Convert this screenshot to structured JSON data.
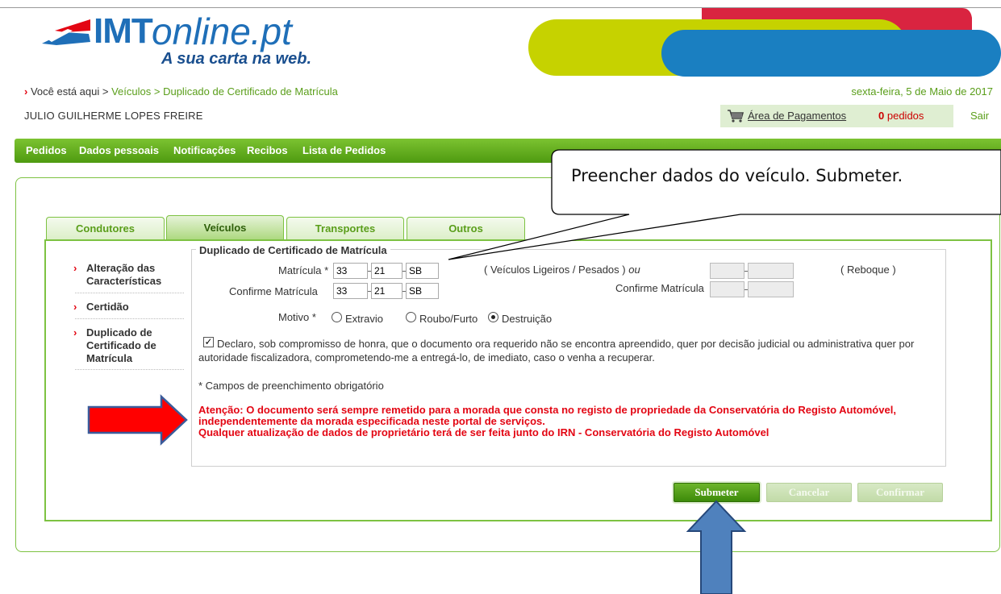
{
  "header": {
    "logo_imt": "IMT",
    "logo_online": "online.pt",
    "logo_tagline": "A sua carta na web.",
    "breadcrumb_prefix": "Você está aqui >",
    "breadcrumb_items": [
      "Veículos",
      "> Duplicado de Certificado de Matrícula"
    ],
    "date": "sexta-feira, 5 de Maio de 2017",
    "user_name": "JULIO GUILHERME LOPES FREIRE",
    "payments_link": "Área de Pagamentos",
    "orders_count": "0",
    "orders_label": "pedidos",
    "logout": "Sair"
  },
  "nav": {
    "items": [
      "Pedidos",
      "Dados pessoais",
      "Notificações",
      "Recibos",
      "Lista de Pedidos"
    ]
  },
  "tabs": [
    "Condutores",
    "Veículos",
    "Transportes",
    "Outros"
  ],
  "active_tab": "Veículos",
  "side_menu": [
    "Alteração das Características",
    "Certidão",
    "Duplicado de Certificado de Matrícula"
  ],
  "form": {
    "legend": "Duplicado de Certificado de Matrícula",
    "plate_label": "Matrícula *",
    "plate_confirm_label": "Confirme Matrícula",
    "plate_parts": [
      "33",
      "21",
      "SB"
    ],
    "plate_confirm_parts": [
      "33",
      "21",
      "SB"
    ],
    "vehicle_type_note": "( Veículos Ligeiros / Pesados )",
    "or_label": "ou",
    "trailer_note": "( Reboque )",
    "trailer_confirm_label": "Confirme Matrícula",
    "motive_label": "Motivo *",
    "motive_options": [
      "Extravio",
      "Roubo/Furto",
      "Destruição"
    ],
    "motive_selected": "Destruição",
    "declaration_checked": true,
    "declaration_line1": "Declaro, sob compromisso de honra, que o documento ora requerido não se encontra apreendido, quer por decisão judicial ou administrativa quer por",
    "declaration_line2": "autoridade fiscalizadora, comprometendo-me a entregá-lo, de imediato, caso o venha a recuperar.",
    "required_note": "* Campos de preenchimento obrigatório",
    "warning_line1": "Atenção: O documento será sempre remetido para a morada que consta no registo de propriedade da Conservatória do Registo Automóvel,",
    "warning_line2": "independentemente da morada especificada neste portal de serviços.",
    "warning_line3": "Qualquer atualização de dados de proprietário terá de ser feita junto do IRN - Conservatória do Registo Automóvel"
  },
  "buttons": {
    "submit": "Submeter",
    "cancel": "Cancelar",
    "confirm": "Confirmar"
  },
  "annotation": {
    "callout_text": "Preencher dados do veículo. Submeter."
  },
  "colors": {
    "brand_green": "#5a9e1a",
    "brand_blue": "#1f6fb8",
    "warning_red": "#e30613",
    "arrow_red": "#ff0000",
    "arrow_blue": "#4f81bd"
  }
}
